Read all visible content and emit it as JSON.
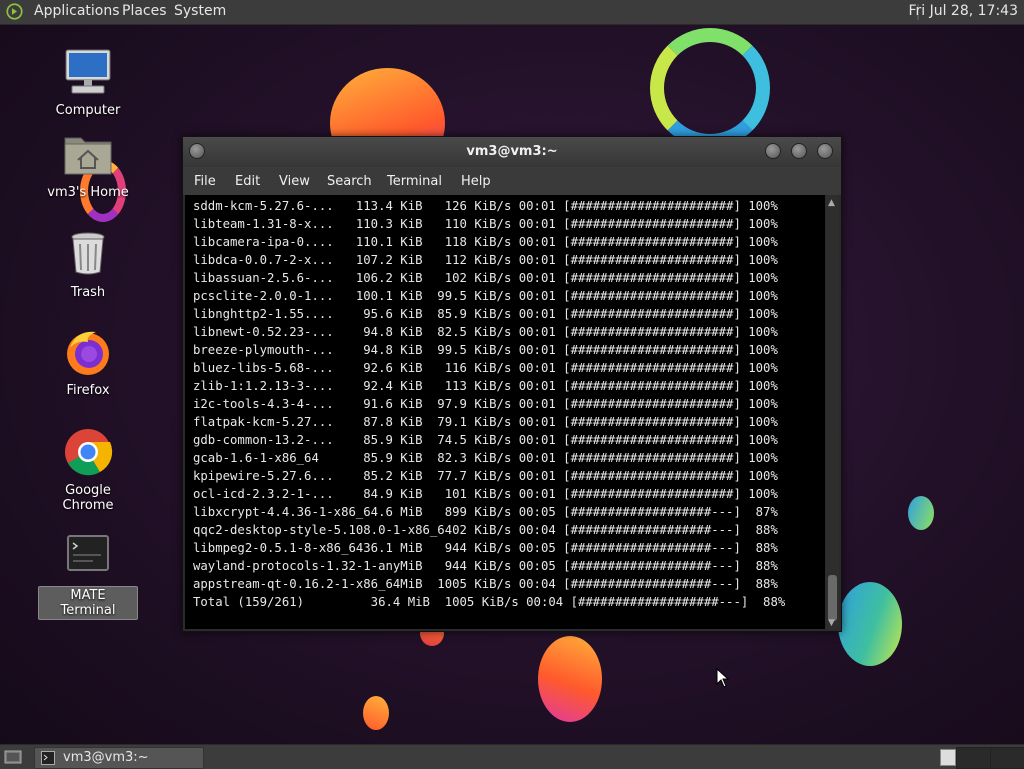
{
  "top_panel": {
    "menus": [
      "Applications",
      "Places",
      "System"
    ],
    "clock": "Fri Jul 28, 17:43"
  },
  "desktop_icons": [
    {
      "label": "Computer",
      "icon": "computer-icon"
    },
    {
      "label": "vm3's Home",
      "icon": "home-folder-icon"
    },
    {
      "label": "Trash",
      "icon": "trash-icon"
    },
    {
      "label": "Firefox",
      "icon": "firefox-icon"
    },
    {
      "label": "Google Chrome",
      "icon": "chrome-icon"
    },
    {
      "label": "MATE Terminal",
      "icon": "terminal-icon"
    }
  ],
  "window": {
    "title": "vm3@vm3:~",
    "menu": [
      "File",
      "Edit",
      "View",
      "Search",
      "Terminal",
      "Help"
    ],
    "lines": [
      "sddm-kcm-5.27.6-...   113.4 KiB   126 KiB/s 00:01 [######################] 100%",
      "libteam-1.31-8-x...   110.3 KiB   110 KiB/s 00:01 [######################] 100%",
      "libcamera-ipa-0....   110.1 KiB   118 KiB/s 00:01 [######################] 100%",
      "libdca-0.0.7-2-x...   107.2 KiB   112 KiB/s 00:01 [######################] 100%",
      "libassuan-2.5.6-...   106.2 KiB   102 KiB/s 00:01 [######################] 100%",
      "pcsclite-2.0.0-1...   100.1 KiB  99.5 KiB/s 00:01 [######################] 100%",
      "libnghttp2-1.55....    95.6 KiB  85.9 KiB/s 00:01 [######################] 100%",
      "libnewt-0.52.23-...    94.8 KiB  82.5 KiB/s 00:01 [######################] 100%",
      "breeze-plymouth-...    94.8 KiB  99.5 KiB/s 00:01 [######################] 100%",
      "bluez-libs-5.68-...    92.6 KiB   116 KiB/s 00:01 [######################] 100%",
      "zlib-1:1.2.13-3-...    92.4 KiB   113 KiB/s 00:01 [######################] 100%",
      "i2c-tools-4.3-4-...    91.6 KiB  97.9 KiB/s 00:01 [######################] 100%",
      "flatpak-kcm-5.27...    87.8 KiB  79.1 KiB/s 00:01 [######################] 100%",
      "gdb-common-13.2-...    85.9 KiB  74.5 KiB/s 00:01 [######################] 100%",
      "gcab-1.6-1-x86_64      85.9 KiB  82.3 KiB/s 00:01 [######################] 100%",
      "kpipewire-5.27.6...    85.2 KiB  77.7 KiB/s 00:01 [######################] 100%",
      "ocl-icd-2.3.2-1-...    84.9 KiB   101 KiB/s 00:01 [######################] 100%",
      "libxcrypt-4.4.36-1-x86_64.6 MiB   899 KiB/s 00:05 [###################---]  87%",
      "qqc2-desktop-style-5.108.0-1-x86_6402 KiB/s 00:04 [###################---]  88%",
      "libmpeg2-0.5.1-8-x86_6436.1 MiB   944 KiB/s 00:05 [###################---]  88%",
      "wayland-protocols-1.32-1-anyMiB   944 KiB/s 00:05 [###################---]  88%",
      "appstream-qt-0.16.2-1-x86_64MiB  1005 KiB/s 00:04 [###################---]  88%",
      "Total (159/261)         36.4 MiB  1005 KiB/s 00:04 [###################---]  88%"
    ]
  },
  "taskbar": {
    "window_button": "vm3@vm3:~"
  }
}
